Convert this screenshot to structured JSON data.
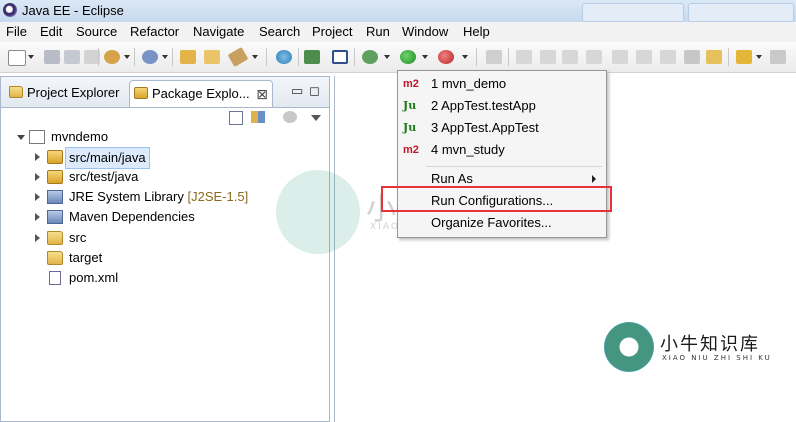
{
  "window": {
    "title": "Java EE - Eclipse"
  },
  "menubar": [
    "File",
    "Edit",
    "Source",
    "Refactor",
    "Navigate",
    "Search",
    "Project",
    "Run",
    "Window",
    "Help"
  ],
  "views": {
    "tabs": [
      {
        "label": "Project Explorer",
        "icon": "project-explorer-icon",
        "active": false
      },
      {
        "label": "Package Explo...",
        "icon": "package-explorer-icon",
        "active": true,
        "close": "⊠"
      }
    ],
    "minimize": "▭",
    "maximize": "◻"
  },
  "tree": [
    {
      "label": "mvndemo",
      "icon": "maven-project-icon",
      "expanded": true,
      "level": 0
    },
    {
      "label": "src/main/java",
      "icon": "source-folder-icon",
      "expanded": false,
      "level": 1,
      "selected": true
    },
    {
      "label": "src/test/java",
      "icon": "source-folder-icon",
      "expanded": false,
      "level": 1
    },
    {
      "label": "JRE System Library",
      "decoration": "[J2SE-1.5]",
      "icon": "library-icon",
      "expanded": false,
      "level": 1
    },
    {
      "label": "Maven Dependencies",
      "icon": "library-icon",
      "expanded": false,
      "level": 1
    },
    {
      "label": "src",
      "icon": "folder-icon",
      "expanded": false,
      "level": 1
    },
    {
      "label": "target",
      "icon": "folder-icon",
      "level": 1
    },
    {
      "label": "pom.xml",
      "icon": "pom-file-icon",
      "level": 1
    }
  ],
  "run_menu": {
    "items": [
      {
        "badge": "m2",
        "label": "1 mvn_demo"
      },
      {
        "badge": "Ju",
        "label": "2 AppTest.testApp"
      },
      {
        "badge": "Ju",
        "label": "3 AppTest.AppTest"
      },
      {
        "badge": "m2",
        "label": "4 mvn_study"
      }
    ],
    "run_as": "Run As",
    "run_configurations": "Run Configurations...",
    "organize_favorites": "Organize Favorites..."
  },
  "watermark": {
    "chinese": "小牛知识库",
    "pinyin": "XIAO NIU ZHI SHI KU"
  },
  "colors": {
    "highlight_box": "#e5333a",
    "selection": "#ddeafb"
  }
}
